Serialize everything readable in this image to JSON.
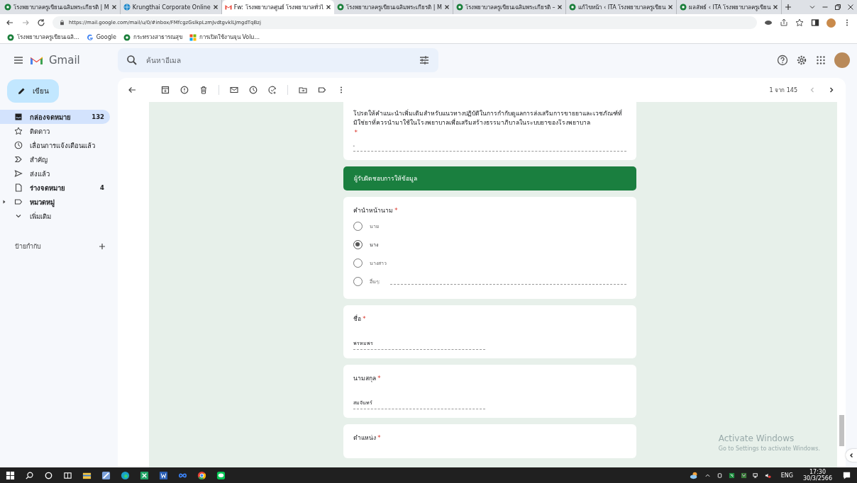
{
  "browser": {
    "tabs": [
      {
        "title": "โรงพยาบาลครูเขียนเฉลิมพระเกียรติ | M",
        "selected": false
      },
      {
        "title": "Krungthai Corporate Online",
        "selected": false
      },
      {
        "title": "Fw: โรงพยาบาลศูนย์ โรงพยาบาลทั่วไ",
        "selected": true
      },
      {
        "title": "โรงพยาบาลครูเขียนเฉลิมพระเกียรติ | M",
        "selected": false
      },
      {
        "title": "โรงพยาบาลครูเขียนเฉลิมพระเกียรติ –",
        "selected": false
      },
      {
        "title": "แก้ไขหน้า ‹ ITA โรงพยาบาลครูเขียน",
        "selected": false
      },
      {
        "title": "ผลลัพธ์ ‹ ITA โรงพยาบาลครูเขียน",
        "selected": false
      }
    ],
    "url": "https://mail.google.com/mail/u/0/#inbox/FMfcgzGslkpLzmJvdtgvklLJmgdTqBzj",
    "bookmarks": [
      {
        "label": "โรงพยาบาลครูเขียนเฉลิ..."
      },
      {
        "label": "Google"
      },
      {
        "label": "กระทรวงสาธารณสุข"
      },
      {
        "label": "การเปิดใช้งานจุน Volu..."
      }
    ]
  },
  "gmail": {
    "logo_text": "Gmail",
    "search": {
      "placeholder": "ค้นหาอีเมล"
    },
    "compose": "เขียน",
    "nav": [
      {
        "label": "กล่องจดหมาย",
        "count": "132",
        "bold": true,
        "selected": true
      },
      {
        "label": "ติดดาว",
        "bold": false,
        "selected": false
      },
      {
        "label": "เลื่อนการแจ้งเตือนแล้ว",
        "bold": false,
        "selected": false
      },
      {
        "label": "สำคัญ",
        "bold": false,
        "selected": false
      },
      {
        "label": "ส่งแล้ว",
        "bold": false,
        "selected": false
      },
      {
        "label": "ร่างจดหมาย",
        "count": "4",
        "bold": true,
        "selected": false
      },
      {
        "label": "หมวดหมู่",
        "bold": true,
        "selected": false,
        "expandable": true
      },
      {
        "label": "เพิ่มเติม",
        "bold": false,
        "selected": false
      }
    ],
    "labels_heading": "ป้ายกำกับ",
    "pager": "1 จาก 145"
  },
  "form": {
    "intro_question": {
      "text": "โปรดให้คำแนะนำเพิ่มเติมสำหรับแนวทางปฏิบัติในการกำกับดูแลการส่งเสริมการขายยาและเวชภัณฑ์ที่มิใช่ยาที่ควรนำมาใช้ในโรงพยาบาลเพื่อเสริมสร้างธรรมาภิบาลในระบบยาของโรงพยาบาล",
      "required_mark": "*",
      "value": "-"
    },
    "section_header": "ผู้รับผิดชอบการให้ข้อมูล",
    "questions": [
      {
        "kind": "radio",
        "title": "คำนำหน้านาม",
        "required_mark": "*",
        "options": [
          {
            "label": "นาย",
            "selected": false,
            "kind": "choice"
          },
          {
            "label": "นาง",
            "selected": true,
            "kind": "choice"
          },
          {
            "label": "นางสาว",
            "selected": false,
            "kind": "choice"
          },
          {
            "label": "อื่นๆ:",
            "selected": false,
            "kind": "other"
          }
        ]
      },
      {
        "kind": "text",
        "title": "ชื่อ",
        "required_mark": "*",
        "value": "พรหมพร"
      },
      {
        "kind": "text",
        "title": "นามสกุล",
        "required_mark": "*",
        "value": "สมจันทร์"
      },
      {
        "kind": "text",
        "title": "ตำแหน่ง",
        "required_mark": "*"
      }
    ]
  },
  "activation": {
    "title": "Activate Windows",
    "subtitle": "Go to Settings to activate Windows."
  },
  "taskbar": {
    "language": "ENG",
    "time": "17:30",
    "date": "30/3/2566"
  }
}
